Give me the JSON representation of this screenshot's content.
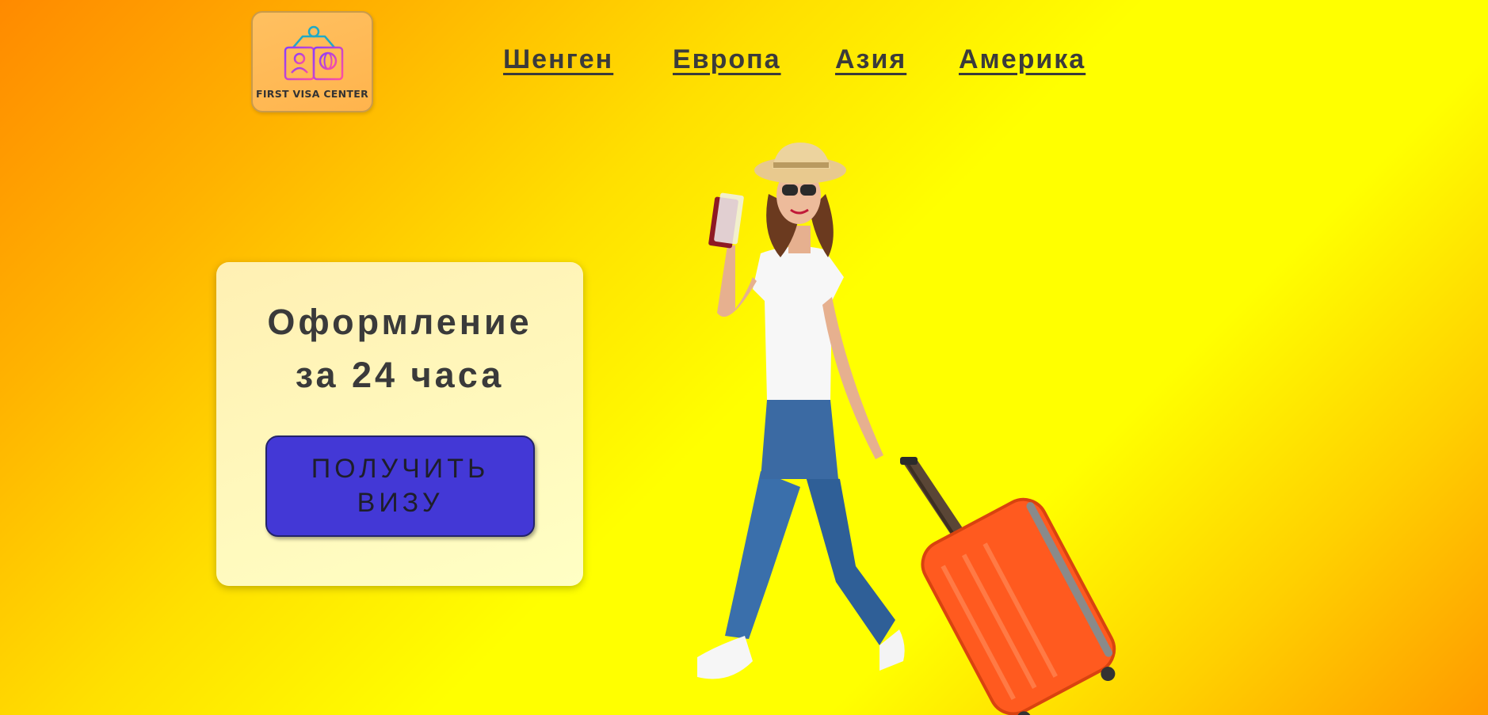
{
  "logo": {
    "text": "FIRST VISA CENTER",
    "icon": "passport-globe-icon",
    "colors": {
      "background": "#ffb44d",
      "icon_gradient_start": "#8a3cff",
      "icon_gradient_end": "#ff4fa0",
      "icon_top": "#20a9c6"
    }
  },
  "nav": {
    "items": [
      {
        "label": "Шенген"
      },
      {
        "label": "Европа"
      },
      {
        "label": "Азия"
      },
      {
        "label": "Америка"
      }
    ]
  },
  "hero": {
    "title_line1": "Оформление",
    "title_line2": "за 24 часа",
    "cta_label": "ПОЛУЧИТЬ\nВИЗУ"
  },
  "image": {
    "subject": "traveler-with-suitcase-image"
  },
  "colors": {
    "background_left": "#ff8a00",
    "background_center": "#ffff00",
    "cta_background": "#4338d6",
    "card_background": "#fff6bf",
    "text": "#3a3a3a",
    "suitcase": "#ff5a1f"
  }
}
